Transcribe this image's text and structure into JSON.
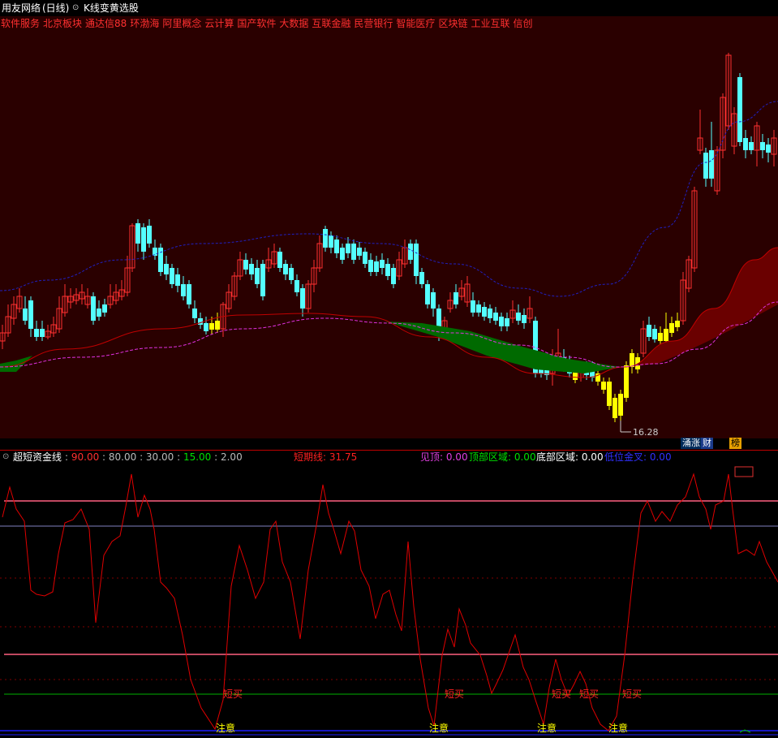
{
  "title": {
    "stock_name": "用友网络",
    "period": "(日线)",
    "formula": "K线变黄选股"
  },
  "concepts": [
    "软件服务",
    "北京板块",
    "通达信88",
    "环渤海",
    "阿里概念",
    "云计算",
    "国产软件",
    "大数据",
    "互联金融",
    "民营银行",
    "智能医疗",
    "区块链",
    "工业互联",
    "信创"
  ],
  "main_chart": {
    "low_marker": "16.28",
    "buttons": [
      "涌涨",
      "财",
      "榜"
    ]
  },
  "indicator": {
    "name": "超短资金线",
    "params": [
      {
        "text": "90.00",
        "color": "#ff3030"
      },
      {
        "text": "80.00",
        "color": "#bbbbbb"
      },
      {
        "text": "30.00",
        "color": "#bbbbbb"
      },
      {
        "text": "15.00",
        "color": "#00e000"
      },
      {
        "text": "2.00",
        "color": "#bbbbbb"
      }
    ],
    "short_line": "短期线: 31.75",
    "see_top": "见顶: 0.00",
    "top_zone": "顶部区域: 0.00",
    "bottom_zone": "底部区域: 0.00",
    "low_golden": "低位金叉: 0.00",
    "signal_buy": "短买",
    "signal_attention": "注意"
  },
  "colors": {
    "background": "#000000",
    "main_panel": "#2a0000",
    "up_candle": "#ff3030",
    "down_candle": "#54ffff",
    "yellow_candle": "#ffff00",
    "ma_blue": "#2020c0",
    "ma_red": "#c00000",
    "ma_magenta": "#e030e0",
    "green_fill": "#006a00",
    "indicator_line": "#e00000"
  }
}
